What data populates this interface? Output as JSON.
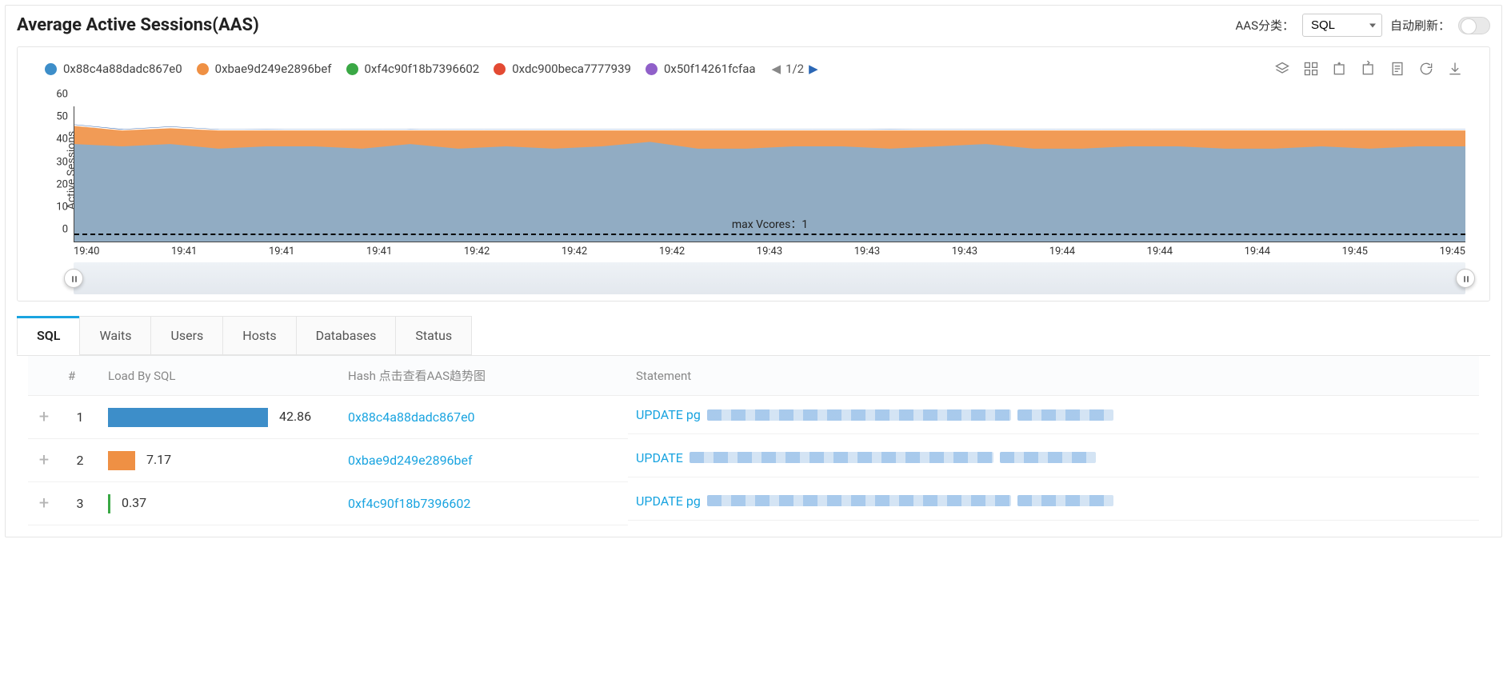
{
  "header": {
    "title": "Average Active Sessions(AAS)",
    "group_label": "AAS分类：",
    "group_value": "SQL",
    "autorefresh_label": "自动刷新：",
    "autorefresh_on": false
  },
  "chart_data": {
    "type": "area",
    "ylabel": "Active Sessions",
    "ylim": [
      0,
      60
    ],
    "yticks": [
      0,
      10,
      20,
      30,
      40,
      50,
      60
    ],
    "x_ticks": [
      "19:40",
      "19:41",
      "19:41",
      "19:41",
      "19:42",
      "19:42",
      "19:42",
      "19:43",
      "19:43",
      "19:43",
      "19:44",
      "19:44",
      "19:44",
      "19:45",
      "19:45"
    ],
    "threshold": {
      "label": "max Vcores：1",
      "value": 1
    },
    "legend_page": "1/2",
    "series": [
      {
        "name": "0x88c4a88dadc867e0",
        "color": "#3d8ec9",
        "values": [
          43,
          42,
          43,
          41,
          42,
          42,
          41,
          43,
          41,
          42,
          41,
          42,
          44,
          41,
          41,
          42,
          42,
          41,
          42,
          43,
          41,
          41,
          42,
          42,
          41,
          41,
          42,
          41,
          42,
          42
        ]
      },
      {
        "name": "0xbae9d249e2896bef",
        "color": "#ef9044",
        "values": [
          8,
          7,
          7,
          8,
          7,
          7,
          8,
          6,
          8,
          7,
          8,
          7,
          5,
          8,
          8,
          7,
          7,
          8,
          7,
          6,
          8,
          8,
          7,
          7,
          8,
          8,
          7,
          8,
          7,
          7
        ]
      },
      {
        "name": "0xf4c90f18b7396602",
        "color": "#3aa845",
        "values": [
          0.4,
          0.3,
          0.5,
          0.3,
          0.4,
          0.3,
          0.4,
          0.5,
          0.3,
          0.4,
          0.3,
          0.4,
          0.4,
          0.3,
          0.4,
          0.4,
          0.3,
          0.4,
          0.3,
          0.4,
          0.4,
          0.3,
          0.4,
          0.3,
          0.4,
          0.3,
          0.4,
          0.3,
          0.4,
          0.3
        ]
      },
      {
        "name": "0xdc900beca7777939",
        "color": "#e34a33",
        "values": [
          0.1,
          0.1,
          0.1,
          0.1,
          0.1,
          0.1,
          0.1,
          0.1,
          0.1,
          0.1,
          0.1,
          0.1,
          0.1,
          0.1,
          0.1,
          0.1,
          0.1,
          0.1,
          0.1,
          0.1,
          0.1,
          0.1,
          0.1,
          0.1,
          0.1,
          0.1,
          0.1,
          0.1,
          0.1,
          0.1
        ]
      },
      {
        "name": "0x50f14261fcfaa",
        "color": "#9060c9",
        "values": [
          0.1,
          0.1,
          0.1,
          0.1,
          0.1,
          0.1,
          0.1,
          0.1,
          0.1,
          0.1,
          0.1,
          0.1,
          0.1,
          0.1,
          0.1,
          0.1,
          0.1,
          0.1,
          0.1,
          0.1,
          0.1,
          0.1,
          0.1,
          0.1,
          0.1,
          0.1,
          0.1,
          0.1,
          0.1,
          0.1
        ]
      }
    ]
  },
  "tabs": {
    "items": [
      "SQL",
      "Waits",
      "Users",
      "Hosts",
      "Databases",
      "Status"
    ],
    "active": 0
  },
  "table": {
    "columns": {
      "idx": "#",
      "load": "Load By SQL",
      "hash": "Hash 点击查看AAS趋势图",
      "stmt": "Statement"
    },
    "rows": [
      {
        "idx": "1",
        "load": "42.86",
        "bar_pct": 100,
        "bar_color": "blue",
        "hash": "0x88c4a88dadc867e0",
        "stmt_prefix": "UPDATE pg"
      },
      {
        "idx": "2",
        "load": "7.17",
        "bar_pct": 17,
        "bar_color": "orange",
        "hash": "0xbae9d249e2896bef",
        "stmt_prefix": "UPDATE"
      },
      {
        "idx": "3",
        "load": "0.37",
        "bar_pct": 1,
        "bar_color": "green",
        "hash": "0xf4c90f18b7396602",
        "stmt_prefix": "UPDATE pg"
      }
    ]
  }
}
